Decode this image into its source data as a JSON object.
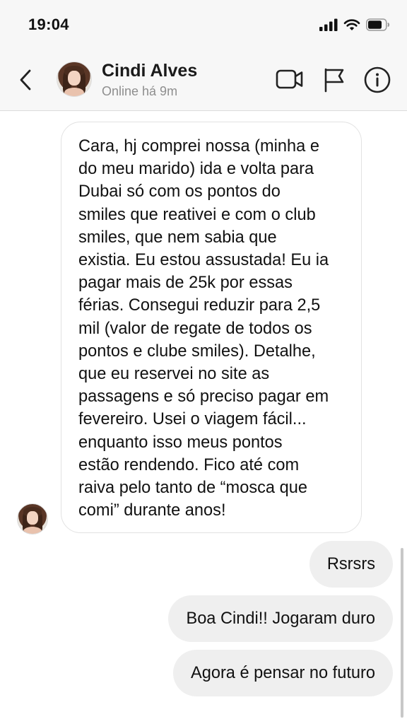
{
  "status_bar": {
    "time": "19:04",
    "icons": [
      "signal-icon",
      "wifi-icon",
      "battery-icon"
    ]
  },
  "header": {
    "back_icon": "chevron-left-icon",
    "contact_name": "Cindi Alves",
    "contact_status": "Online há 9m",
    "actions": [
      "video-call-icon",
      "flag-icon",
      "info-icon"
    ]
  },
  "messages": {
    "incoming": {
      "text": "Cara, hj comprei nossa (minha e\ndo meu marido) ida e volta para\nDubai só com os pontos do\nsmiles que reativei e com o club\nsmiles, que nem sabia que\nexistia. Eu estou assustada! Eu ia\npagar mais de 25k por essas\nférias. Consegui reduzir para 2,5\nmil (valor de regate de todos os\npontos e clube smiles). Detalhe,\nque eu reservei no site as\npassagens e só preciso pagar em\nfevereiro. Usei o viagem fácil...\nenquanto isso meus pontos\nestão rendendo. Fico até com\nraiva pelo tanto de “mosca que\ncomi” durante anos!"
    },
    "outgoing": [
      {
        "text": "Rsrsrs"
      },
      {
        "text": "Boa Cindi!! Jogaram duro"
      },
      {
        "text": "Agora é pensar no futuro"
      }
    ]
  },
  "colors": {
    "header_bg": "#f7f7f7",
    "outgoing_bubble": "#efefef",
    "incoming_border": "#e2e2e2",
    "secondary_text": "#8e8e8e"
  }
}
